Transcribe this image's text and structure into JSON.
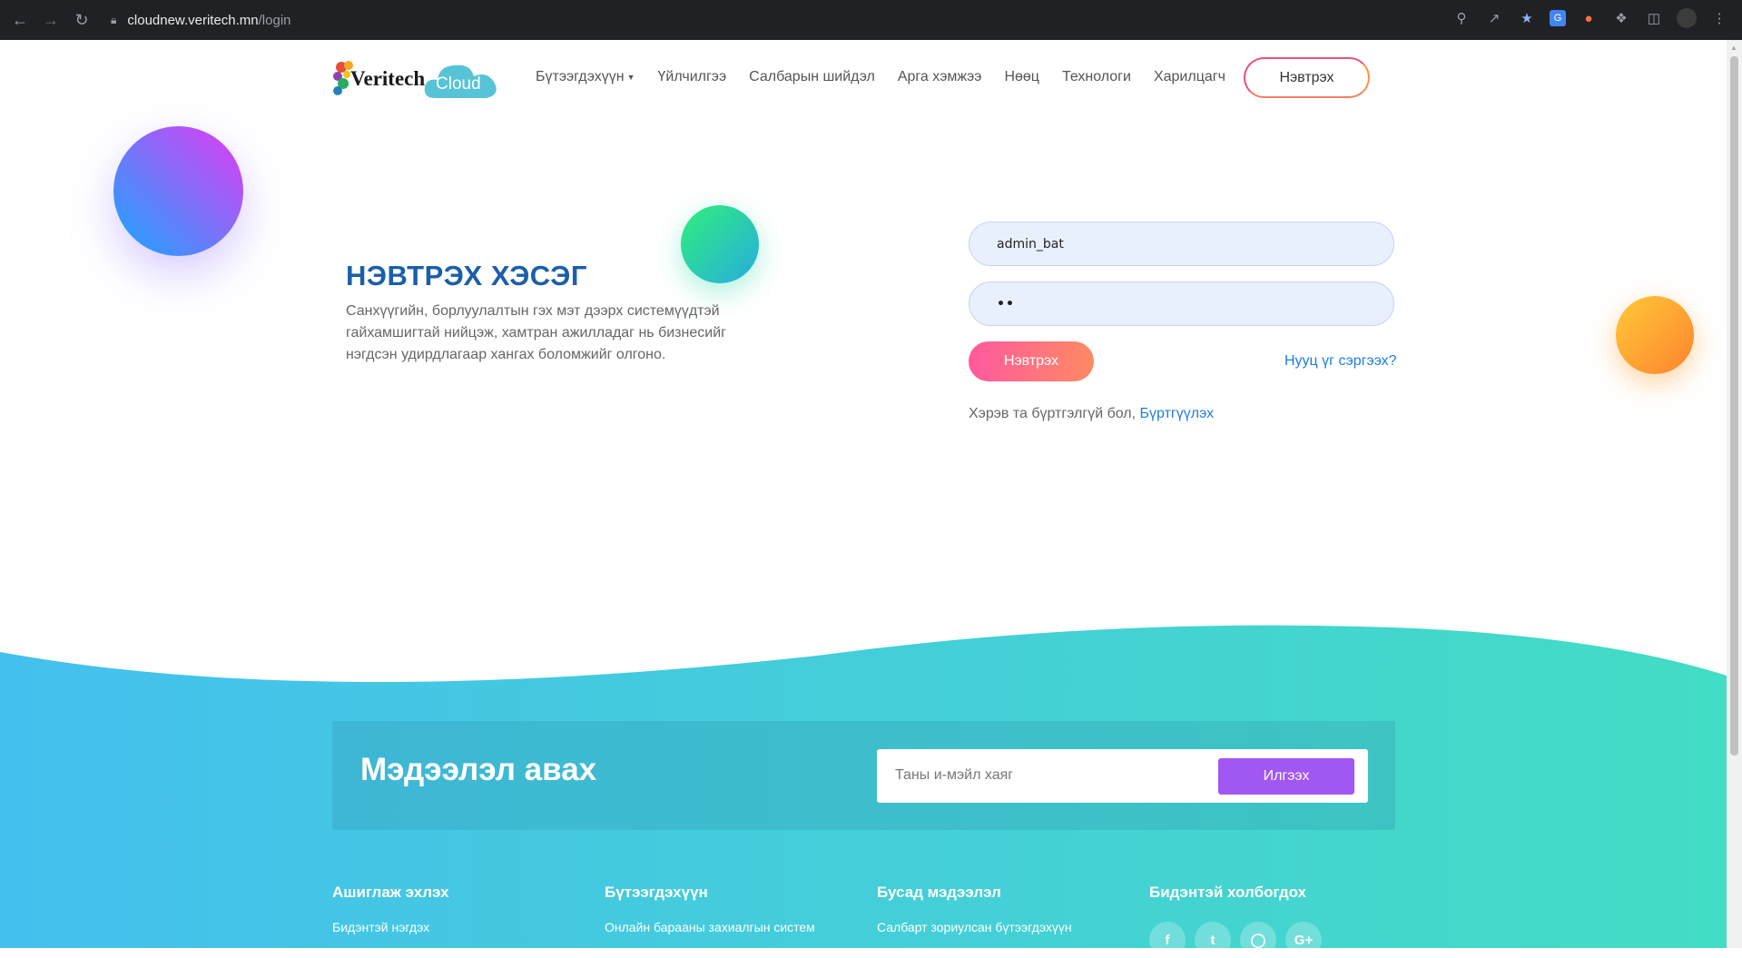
{
  "browser": {
    "url_host": "cloudnew.veritech.mn",
    "url_path": "/login"
  },
  "header": {
    "logo_brand": "Veritech",
    "logo_cloud": "Cloud",
    "nav": [
      {
        "label": "Бүтээгдэхүүн"
      },
      {
        "label": "Үйлчилгээ"
      },
      {
        "label": "Салбарын шийдэл"
      },
      {
        "label": "Арга хэмжээ"
      },
      {
        "label": "Нөөц"
      },
      {
        "label": "Технологи"
      },
      {
        "label": "Харилцагч"
      }
    ],
    "login_button": "Нэвтрэх"
  },
  "hero": {
    "title": "НЭВТРЭХ ХЭСЭГ",
    "description": "Санхүүгийн, борлуулалтын гэх мэт дээрх системүүдтэй гайхамшигтай нийцэж, хамтран ажилладаг нь бизнесийг нэгдсэн удирдлагаар хангах боломжийг олгоно."
  },
  "login_form": {
    "username_value": "admin_bat",
    "password_value": "••",
    "submit_label": "Нэвтрэх",
    "forgot_label": "Нууц үг сэргээх?",
    "register_prefix": "Хэрэв та бүртгэлгүй бол,",
    "register_link": "Бүртгүүлэх"
  },
  "newsletter": {
    "title": "Мэдээлэл авах",
    "email_placeholder": "Таны и-мэйл хаяг",
    "send_label": "Илгээх"
  },
  "footer": {
    "columns": [
      {
        "heading": "Ашиглаж эхлэх",
        "link": "Бидэнтэй нэгдэх"
      },
      {
        "heading": "Бүтээгдэхүүн",
        "link": "Онлайн барааны захиалгын систем"
      },
      {
        "heading": "Бусад мэдээлэл",
        "link": "Салбарт зориулсан бүтээгдэхүүн"
      },
      {
        "heading": "Бидэнтэй холбогдох"
      }
    ],
    "socials": [
      "facebook-icon",
      "twitter-icon",
      "instagram-icon",
      "google-plus-icon"
    ]
  },
  "colors": {
    "accent_blue": "#1e7de0",
    "login_gradient_start": "#ff5a9e",
    "login_gradient_end": "#ff8a63",
    "footer_gradient_start": "#44c0ee",
    "footer_gradient_end": "#43dcc4",
    "send_button": "#a157f2"
  }
}
